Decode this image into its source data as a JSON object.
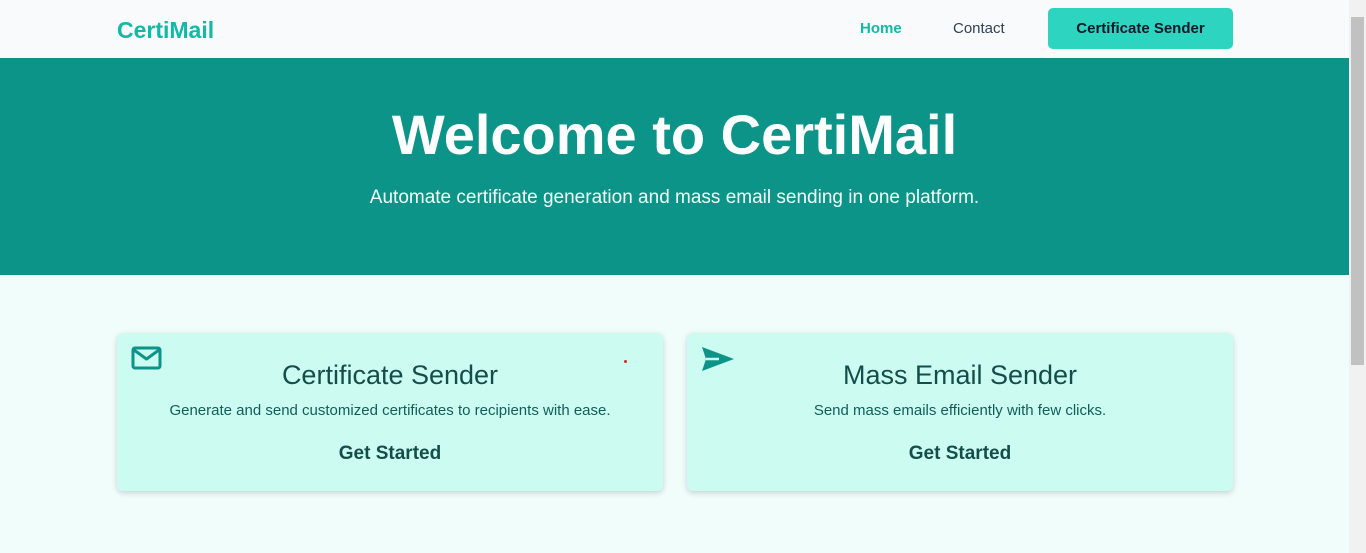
{
  "nav": {
    "brand": "CertiMail",
    "links": [
      {
        "label": "Home",
        "active": true
      },
      {
        "label": "Contact",
        "active": false
      }
    ],
    "cta_label": "Certificate Sender"
  },
  "hero": {
    "title": "Welcome to CertiMail",
    "subtitle": "Automate certificate generation and mass email sending in one platform."
  },
  "cards": [
    {
      "icon": "envelope-icon",
      "title": "Certificate Sender",
      "description": "Generate and send customized certificates to recipients with ease.",
      "action": "Get Started"
    },
    {
      "icon": "paper-plane-icon",
      "title": "Mass Email Sender",
      "description": "Send mass emails efficiently with few clicks.",
      "action": "Get Started"
    }
  ],
  "colors": {
    "brand": "#14b8a6",
    "hero_bg": "#0d9488",
    "cta_bg": "#2dd4bf",
    "card_bg": "#ccfbf1",
    "page_bg": "#f0fdfa"
  }
}
